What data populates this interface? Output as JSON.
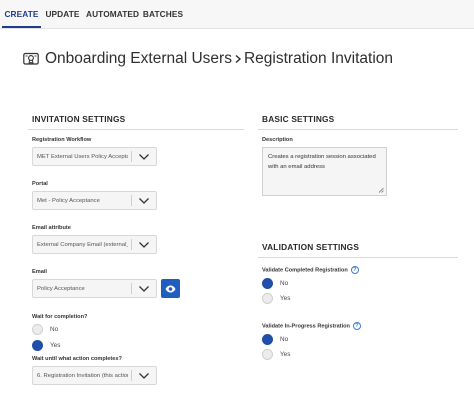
{
  "tabs": [
    {
      "label": "CREATE"
    },
    {
      "label": "UPDATE"
    },
    {
      "label": "AUTOMATED"
    },
    {
      "label": "BATCHES"
    }
  ],
  "header": {
    "icon": "certificate-icon",
    "breadcrumb_parent": "Onboarding External Users",
    "separator": ">",
    "breadcrumb_current": "Registration Invitation"
  },
  "invitation_settings": {
    "title": "INVITATION SETTINGS",
    "registration_workflow": {
      "label": "Registration Workflow",
      "value": "MET External Users Policy Acceptan..."
    },
    "portal": {
      "label": "Portal",
      "value": "Met - Policy Acceptance"
    },
    "email_attribute": {
      "label": "Email attribute",
      "value": "External Company Email (external_c..."
    },
    "email": {
      "label": "Email",
      "value": "Policy Acceptance"
    },
    "wait_for_completion": {
      "label": "Wait for completion?",
      "options": [
        "No",
        "Yes"
      ],
      "selected": "Yes"
    },
    "wait_until": {
      "label": "Wait until what action completes?",
      "value": "6. Registration Invitation (this action)"
    }
  },
  "basic_settings": {
    "title": "BASIC SETTINGS",
    "description_label": "Description",
    "description_value": "Creates a registration session associated with an email address"
  },
  "validation_settings": {
    "title": "VALIDATION SETTINGS",
    "validate_completed": {
      "label": "Validate Completed Registration",
      "options": [
        "No",
        "Yes"
      ],
      "selected": "No"
    },
    "validate_in_progress": {
      "label": "Validate In-Progress Registration",
      "options": [
        "No",
        "Yes"
      ],
      "selected": "No"
    },
    "help_glyph": "?"
  },
  "colors": {
    "accent": "#1f3d8a",
    "radio_selected": "#1f4fa8",
    "eye_button": "#1f5fbf"
  }
}
